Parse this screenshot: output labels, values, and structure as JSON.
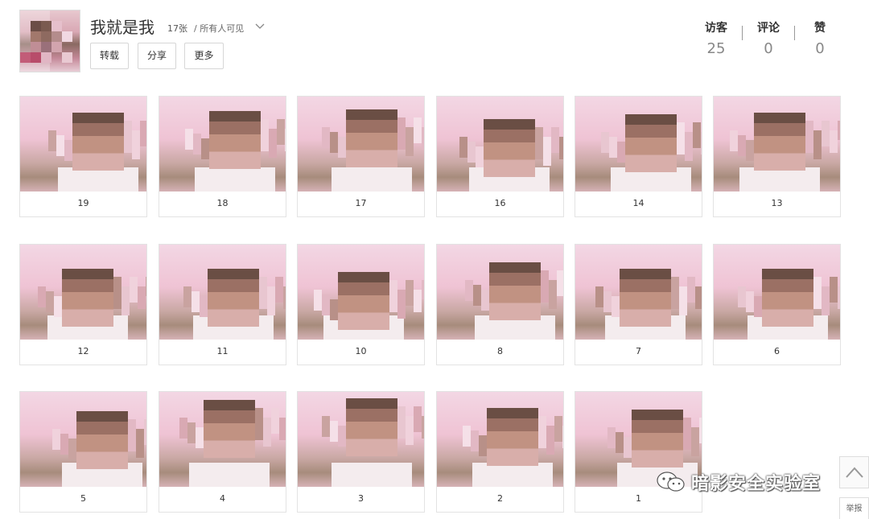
{
  "album": {
    "title": "我就是我",
    "count": "17张",
    "visibility": "/ 所有人可见"
  },
  "actions": {
    "repost": "转载",
    "share": "分享",
    "more": "更多"
  },
  "stats": {
    "visitors_label": "访客",
    "visitors_value": "25",
    "comments_label": "评论",
    "comments_value": "0",
    "likes_label": "赞",
    "likes_value": "0"
  },
  "photos": [
    {
      "caption": "19"
    },
    {
      "caption": "18"
    },
    {
      "caption": "17"
    },
    {
      "caption": "16"
    },
    {
      "caption": "14"
    },
    {
      "caption": "13"
    },
    {
      "caption": "12"
    },
    {
      "caption": "11"
    },
    {
      "caption": "10"
    },
    {
      "caption": "8"
    },
    {
      "caption": "7"
    },
    {
      "caption": "6"
    },
    {
      "caption": "5"
    },
    {
      "caption": "4"
    },
    {
      "caption": "3"
    },
    {
      "caption": "2"
    },
    {
      "caption": "1"
    }
  ],
  "watermark": {
    "text": "暗影安全实验室",
    "icon": "wechat-icon"
  },
  "sidebar": {
    "report": "举报",
    "scroll_top_icon": "chevron-up-icon"
  },
  "colors": {
    "photo_bg_top": "#f3d7e4",
    "stat_number": "#888888",
    "border": "#d6d6d6"
  }
}
